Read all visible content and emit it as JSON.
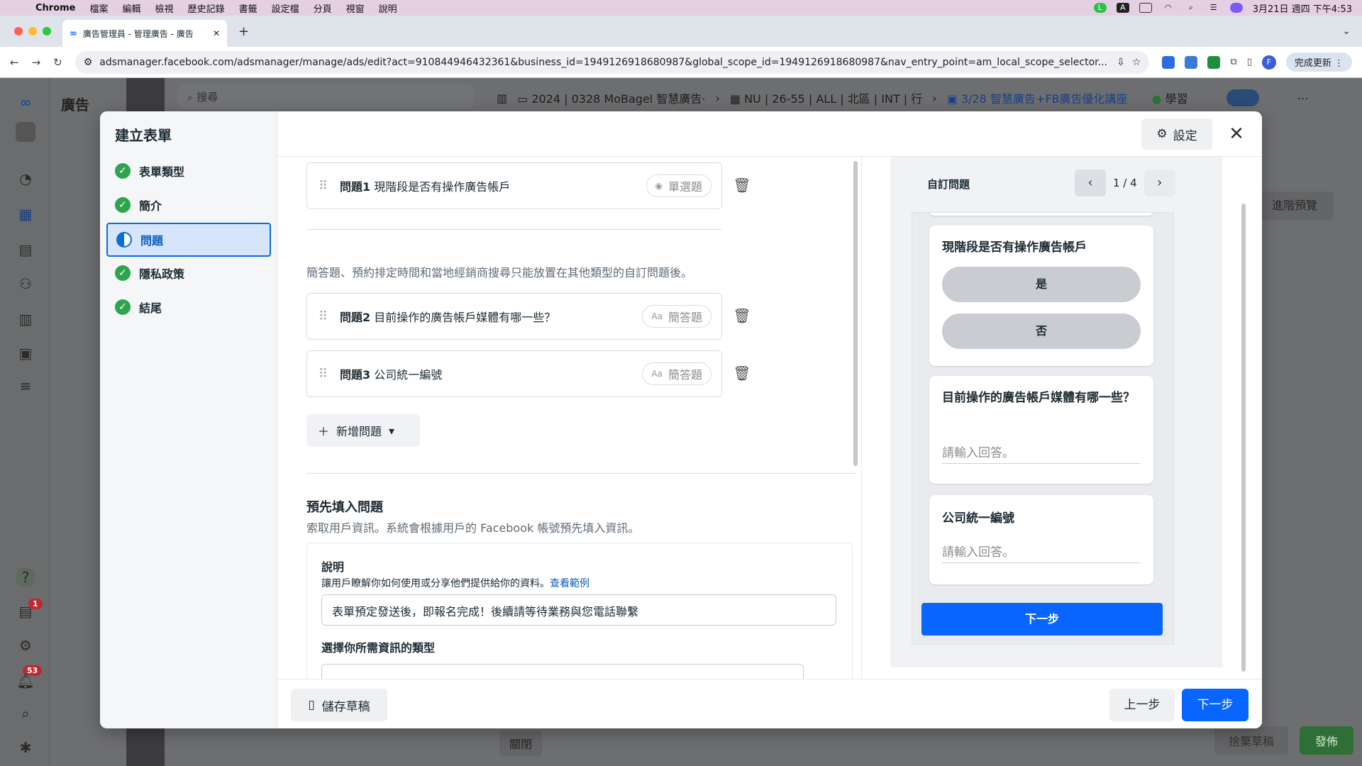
{
  "menubar": {
    "app": "Chrome",
    "items": [
      "檔案",
      "編輯",
      "檢視",
      "歷史記錄",
      "書籤",
      "設定檔",
      "分頁",
      "視窗",
      "說明"
    ],
    "clock": "3月21日 週四 下午4:53"
  },
  "browser": {
    "tab_title": "廣告管理員 - 管理廣告 - 廣告",
    "url": "adsmanager.facebook.com/adsmanager/manage/ads/edit?act=910844946432361&business_id=1949126918680987&global_scope_id=1949126918680987&nav_entry_point=am_local_scope_selector...",
    "update_label": "完成更新",
    "profile_initial": "F"
  },
  "background": {
    "title": "廣告",
    "search_placeholder": "搜尋",
    "crumb1": "2024 | 0328 MoBagel 智慧廣告·",
    "crumb2": "NU | 26-55 | ALL | 北區 | INT | 行",
    "crumb3": "3/28 智慧廣告+FB廣告優化講座",
    "learning": "學習",
    "advanced_preview": "進階預覽",
    "close_label": "關閉",
    "discard_label": "捨棄草稿",
    "publish_label": "發佈",
    "notif_badge": "1",
    "alerts_badge": "53"
  },
  "modal": {
    "title": "建立表單",
    "steps": [
      {
        "label": "表單類型",
        "status": "done"
      },
      {
        "label": "簡介",
        "status": "done"
      },
      {
        "label": "問題",
        "status": "active"
      },
      {
        "label": "隱私政策",
        "status": "done"
      },
      {
        "label": "結尾",
        "status": "done"
      }
    ],
    "settings_label": "設定",
    "questions": [
      {
        "num": "問題1",
        "text": "現階段是否有操作廣告帳戶",
        "type": "單選題"
      },
      {
        "num": "問題2",
        "text": "目前操作的廣告帳戶媒體有哪一些？",
        "type": "簡答題"
      },
      {
        "num": "問題3",
        "text": "公司統一編號",
        "type": "簡答題"
      }
    ],
    "hint": "簡答題、預約排定時間和當地經銷商搜尋只能放置在其他類型的自訂問題後。",
    "add_question": "新增問題",
    "prefill_title": "預先填入問題",
    "prefill_sub": "索取用戶資訊。系統會根據用戶的 Facebook 帳號預先填入資訊。",
    "desc_label": "說明",
    "desc_help": "讓用戶瞭解你如何使用或分享他們提供給你的資料。",
    "desc_link": "查看範例",
    "desc_value": "表單預定發送後，即報名完成！後續請等待業務與您電話聯繫",
    "info_type_label": "選擇你所需資訊的類型",
    "save_draft": "儲存草稿",
    "prev": "上一步",
    "next": "下一步"
  },
  "preview": {
    "label": "自訂問題",
    "page": "1 / 4",
    "q1": "現階段是否有操作廣告帳戶",
    "q1_options": [
      "是",
      "否"
    ],
    "q2": "目前操作的廣告帳戶媒體有哪一些？",
    "q3": "公司統一編號",
    "placeholder": "請輸入回答。",
    "next": "下一步"
  }
}
